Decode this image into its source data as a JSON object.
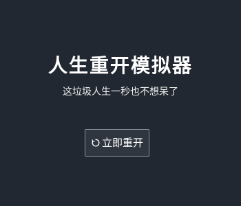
{
  "game": {
    "title": "人生重开模拟器",
    "subtitle": "这垃圾人生一秒也不想呆了",
    "restart_button": {
      "label": "立即重开",
      "icon": "restart-icon"
    }
  },
  "colors": {
    "background": "#222831",
    "text": "#ffffff",
    "button_border": "#8a8f96"
  }
}
